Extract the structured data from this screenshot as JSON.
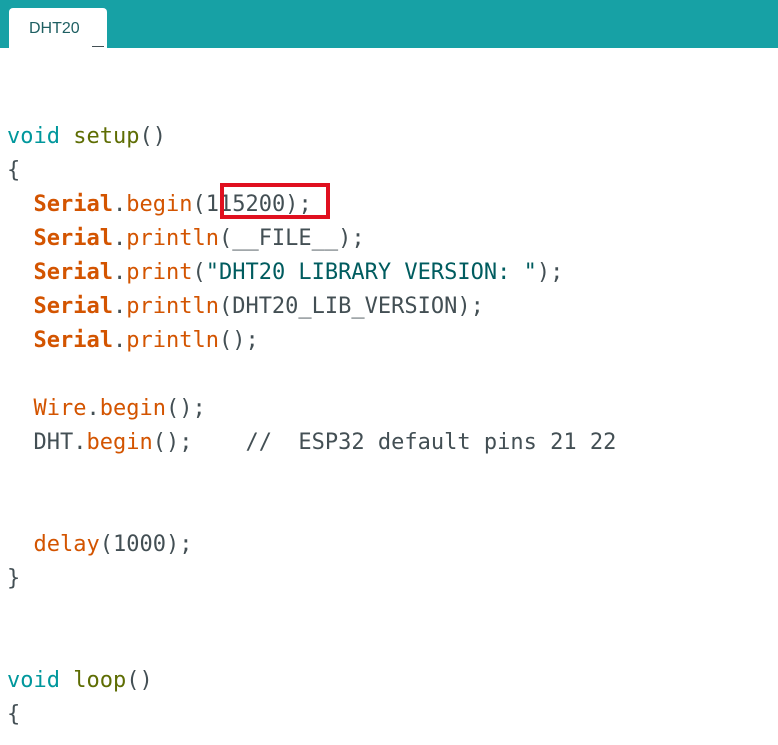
{
  "tab": {
    "label": "DHT20"
  },
  "code": {
    "line1_type": "void",
    "line1_func": "setup",
    "line1_rest": "()",
    "brace_open": "{",
    "l3_class": "Serial",
    "l3_dot": ".",
    "l3_method": "begin",
    "l3_arg": "(115200)",
    "l3_end": ";",
    "l4_class": "Serial",
    "l4_dot": ".",
    "l4_method": "println",
    "l4_arg": "(__FILE__);",
    "l5_class": "Serial",
    "l5_dot": ".",
    "l5_method": "print",
    "l5_open": "(",
    "l5_str": "\"DHT20 LIBRARY VERSION: \"",
    "l5_end": ");",
    "l6_class": "Serial",
    "l6_dot": ".",
    "l6_method": "println",
    "l6_arg": "(DHT20_LIB_VERSION);",
    "l7_class": "Serial",
    "l7_dot": ".",
    "l7_method": "println",
    "l7_arg": "();",
    "l9_class": "Wire",
    "l9_dot": ".",
    "l9_method": "begin",
    "l9_arg": "();",
    "l10_obj": "DHT.",
    "l10_method": "begin",
    "l10_arg": "();",
    "l10_comment": "//  ESP32 default pins 21 22",
    "l13_func": "delay",
    "l13_arg": "(1000);",
    "brace_close": "}",
    "loop_type": "void",
    "loop_func": "loop",
    "loop_rest": "()",
    "loop_brace": "{"
  },
  "highlight": {
    "color": "#e0101f",
    "target": "115200"
  },
  "colors": {
    "tabbar": "#17a1a5",
    "type": "#00979c",
    "class": "#d35400",
    "text": "#434f54"
  }
}
